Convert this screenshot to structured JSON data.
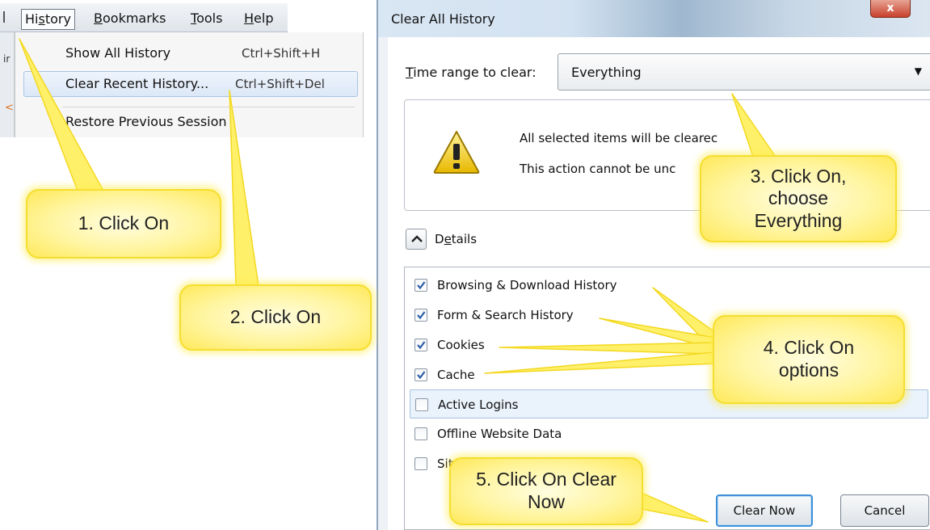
{
  "menubar": {
    "items": [
      {
        "label": "History",
        "mnemonic": "s",
        "before": "Hi",
        "after": "tory"
      },
      {
        "label": "Bookmarks",
        "mnemonic": "B",
        "before": "",
        "after": "ookmarks"
      },
      {
        "label": "Tools",
        "mnemonic": "T",
        "before": "",
        "after": "ools"
      },
      {
        "label": "Help",
        "mnemonic": "H",
        "before": "",
        "after": "elp"
      }
    ]
  },
  "background_strip": {
    "text1": "ir",
    "text2": "<"
  },
  "history_menu": {
    "items": [
      {
        "label": "Show All History",
        "shortcut": "Ctrl+Shift+H"
      },
      {
        "label": "Clear Recent History...",
        "shortcut": "Ctrl+Shift+Del"
      },
      {
        "label": "Restore Previous Session",
        "shortcut": ""
      }
    ]
  },
  "dialog": {
    "title": "Clear All History",
    "close_symbol": "x",
    "time_range": {
      "label_pre": "",
      "label_mnemonic": "T",
      "label_post": "ime range to clear:",
      "value": "Everything"
    },
    "warning": {
      "line1": "All selected items will be clearec",
      "line2": "This action cannot be unc"
    },
    "details": {
      "label_pre": "D",
      "label_mnemonic": "e",
      "label_post": "tails"
    },
    "options": [
      {
        "label": "Browsing & Download History",
        "checked": true
      },
      {
        "label": "Form & Search History",
        "checked": true
      },
      {
        "label": "Cookies",
        "checked": true
      },
      {
        "label": "Cache",
        "checked": true
      },
      {
        "label": "Active Logins",
        "checked": false
      },
      {
        "label": "Offline Website Data",
        "checked": false
      },
      {
        "label": "Sit",
        "checked": false
      }
    ],
    "buttons": {
      "clear_now": "Clear Now",
      "cancel": "Cancel"
    }
  },
  "callouts": {
    "c1": "1. Click On",
    "c2": "2. Click On",
    "c3_line1": "3. Click On,",
    "c3_line2": "choose",
    "c3_line3": "Everything",
    "c4_line1": "4. Click On",
    "c4_line2": "options",
    "c5_line1": "5. Click On Clear",
    "c5_line2": "Now"
  },
  "colors": {
    "callout_fill": "#fff5a0",
    "callout_border": "#f5de30",
    "check_mark": "#2c5fa8"
  }
}
